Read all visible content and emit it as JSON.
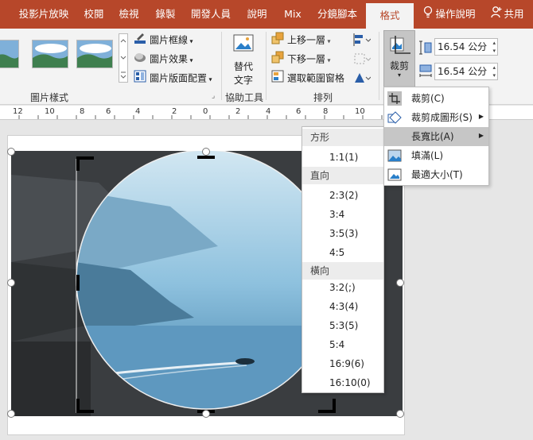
{
  "tabs": [
    "投影片放映",
    "校閱",
    "檢視",
    "錄製",
    "開發人員",
    "說明",
    "Mix",
    "分鏡腳本",
    "格式"
  ],
  "tellme": "操作說明",
  "share": "共用",
  "ribbon": {
    "picture_border": "圖片框線",
    "picture_effects": "圖片效果",
    "picture_layout": "圖片版面配置",
    "picture_styles_label": "圖片樣式",
    "alt_text_line1": "替代",
    "alt_text_line2": "文字",
    "accessibility_label": "協助工具",
    "bring_forward": "上移一層",
    "send_backward": "下移一層",
    "selection_pane": "選取範圍窗格",
    "arrange_label": "排列",
    "crop_label": "裁剪",
    "height_value": "16.54 公分",
    "width_value": "16.54 公分"
  },
  "ruler_labels": [
    "12",
    "10",
    "8",
    "6",
    "4",
    "2",
    "0",
    "2",
    "4",
    "6",
    "8",
    "10",
    "12"
  ],
  "crop_menu": {
    "items": [
      "裁剪(C)",
      "裁剪成圖形(S)",
      "長寬比(A)",
      "填滿(L)",
      "最適大小(T)"
    ]
  },
  "aspect_menu": {
    "square_header": "方形",
    "square_items": [
      "1:1(1)"
    ],
    "portrait_header": "直向",
    "portrait_items": [
      "2:3(2)",
      "3:4",
      "3:5(3)",
      "4:5"
    ],
    "landscape_header": "橫向",
    "landscape_items": [
      "3:2(;)",
      "4:3(4)",
      "5:3(5)",
      "5:4",
      "16:9(6)",
      "16:10(0)"
    ]
  }
}
